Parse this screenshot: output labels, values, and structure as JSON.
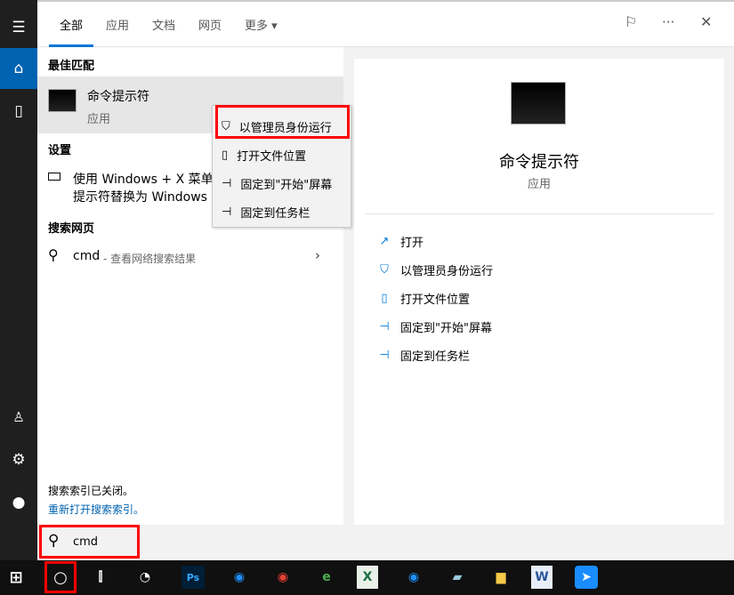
{
  "tabs": [
    {
      "label": "全部"
    },
    {
      "label": "应用"
    },
    {
      "label": "文档"
    },
    {
      "label": "网页"
    },
    {
      "label": "更多 ▾"
    }
  ],
  "header_icons": [
    "feedback-icon",
    "more-icon",
    "close-icon"
  ],
  "header_glyphs": {
    "more": "···",
    "close": "✕",
    "feedback": "⚐"
  },
  "sections": {
    "best_match": "最佳匹配",
    "settings": "设置",
    "web": "搜索网页"
  },
  "best": {
    "title": "命令提示符",
    "subtitle": "应用"
  },
  "setting_item": {
    "line1": "使用 Windows + X 菜单",
    "line2": "提示符替换为 Windows"
  },
  "web_item": {
    "query": "cmd",
    "suffix": " - 查看网络搜索结果"
  },
  "index": {
    "text": "搜索索引已关闭。",
    "link": "重新打开搜索索引。"
  },
  "context_menu": [
    {
      "label": "以管理员身份运行",
      "icon": "shield-icon"
    },
    {
      "label": "打开文件位置",
      "icon": "folder-icon"
    },
    {
      "label": "固定到\"开始\"屏幕",
      "icon": "pin-icon"
    },
    {
      "label": "固定到任务栏",
      "icon": "pin-icon"
    }
  ],
  "detail": {
    "title": "命令提示符",
    "subtitle": "应用",
    "actions": [
      {
        "label": "打开",
        "icon": "open-icon"
      },
      {
        "label": "以管理员身份运行",
        "icon": "shield-icon"
      },
      {
        "label": "打开文件位置",
        "icon": "folder-icon"
      },
      {
        "label": "固定到\"开始\"屏幕",
        "icon": "pin-icon"
      },
      {
        "label": "固定到任务栏",
        "icon": "pin-icon"
      }
    ]
  },
  "search": {
    "value": "cmd"
  },
  "taskbar": {
    "ps": "Ps",
    "apps": [
      "photoshop",
      "browser",
      "chrome",
      "ie",
      "excel",
      "browser",
      "notepad",
      "file-explorer",
      "word",
      "feishu"
    ]
  },
  "colors": {
    "accent": "#0078d7",
    "highlight": "#f00"
  }
}
